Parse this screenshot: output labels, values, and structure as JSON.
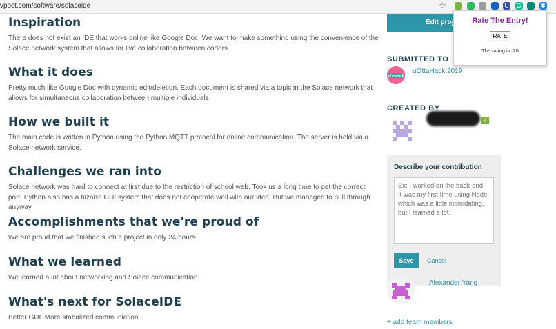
{
  "browser": {
    "url": "vpost.com/software/solaceide",
    "extension_icons": [
      {
        "name": "lemon-icon",
        "color": "#7cb342",
        "glyph": "●"
      },
      {
        "name": "evernote-icon",
        "color": "#2dbe60",
        "glyph": "●"
      },
      {
        "name": "grey-ext-icon",
        "color": "#9e9e9e",
        "glyph": "●"
      },
      {
        "name": "blue-circle-icon",
        "color": "#1565c0",
        "glyph": "●"
      },
      {
        "name": "ui-ext-icon",
        "color": "#3949ab",
        "glyph": "U"
      },
      {
        "name": "grammarly-icon",
        "color": "#15c39a",
        "glyph": "G"
      },
      {
        "name": "teal-ext-icon",
        "color": "#00897b",
        "glyph": "●"
      },
      {
        "name": "puzzle-icon",
        "color": "#1e88e5",
        "glyph": "✱"
      }
    ]
  },
  "sections": [
    {
      "title": "Inspiration",
      "text": "There does not exist an IDE that works online like Google Doc. We want to make something using the convenience of the Solace network system that allows for live collaboration between coders."
    },
    {
      "title": "What it does",
      "text": "Pretty much like Google Doc with dynamic edit/deletion. Each document is shared via a topic in the Solace network that allows for simultaneous collaboration between multiple individuals."
    },
    {
      "title": "How we built it",
      "text": "The main code is written in Python using the Python MQTT protocol for online communication. The server is held via a Solace network service."
    },
    {
      "title": "Challenges we ran into",
      "text": "Solace network was hard to connect at first due to the restriction of school web. Took us a long time to get the correct port. Python also has a bizarre GUI system that does not cooperate well with our idea. But we managed to pull through anyway."
    },
    {
      "title": "Accomplishments that we're proud of",
      "text": "We are proud that we finished such a project in only 24 hours."
    },
    {
      "title": "What we learned",
      "text": "We learned a lot about networking and Solace communication."
    },
    {
      "title": "What's next for SolaceIDE",
      "text": "Better GUI. More stabalized communiation."
    }
  ],
  "sidebar": {
    "edit_label": "Edit proje",
    "submitted_label": "SUBMITTED TO",
    "hackathon": "uOttaHack 2019",
    "hackathon_logo_text": "uOttaHack",
    "created_by_label": "CREATED BY",
    "contribution": {
      "title": "Describe your contribution",
      "placeholder": "Ex: I worked on the back-end. It was my first time using Node, which was a little intimidating, but I learned a lot.",
      "save": "Save",
      "cancel": "Cancel"
    },
    "member_name": "Alexander Yang",
    "add_members": "+ add team members"
  },
  "popup": {
    "title": "Rate The Entry!",
    "button": "RATE",
    "rating_text": "The rating is: 26"
  }
}
